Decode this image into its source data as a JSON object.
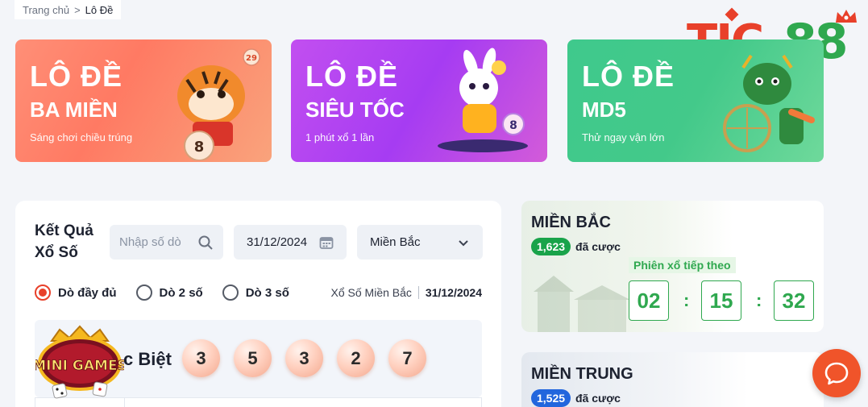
{
  "breadcrumb": {
    "home": "Trang chủ",
    "separator": ">",
    "current": "Lô Đề"
  },
  "logo": {
    "part1": "TIC",
    "part2": "88"
  },
  "banners": [
    {
      "title": "LÔ ĐỀ",
      "subtitle": "BA MIỀN",
      "caption": "Sáng chơi chiều trúng"
    },
    {
      "title": "LÔ ĐỀ",
      "subtitle": "SIÊU TỐC",
      "caption": "1 phút xổ 1 lần"
    },
    {
      "title": "LÔ ĐỀ",
      "subtitle": "MD5",
      "caption": "Thử ngay vận lớn"
    }
  ],
  "results": {
    "title": "Kết Quả Xổ Số",
    "search_placeholder": "Nhập số dò",
    "date_value": "31/12/2024",
    "region_value": "Miền Bắc",
    "radios": [
      {
        "label": "Dò đầy đủ",
        "selected": true
      },
      {
        "label": "Dò 2 số",
        "selected": false
      },
      {
        "label": "Dò 3 số",
        "selected": false
      }
    ],
    "info_region": "Xổ Số Miền Bắc",
    "info_date": "31/12/2024",
    "special_label": "c Biệt",
    "special_numbers": [
      "3",
      "5",
      "3",
      "2",
      "7"
    ]
  },
  "minigames": {
    "label": "MINI GAMES"
  },
  "side_cards": [
    {
      "region": "MIỀN BẮC",
      "bet_count": "1,623",
      "bet_label": "đã cược",
      "next_label": "Phiên xổ tiếp theo",
      "countdown": [
        "02",
        "15",
        "32"
      ]
    },
    {
      "region": "MIỀN TRUNG",
      "bet_count": "1,525",
      "bet_label": "đã cược"
    }
  ],
  "colors": {
    "accent": "#e8402a",
    "green": "#2fa84f",
    "blue": "#2266dd",
    "chat": "#f0542a"
  }
}
